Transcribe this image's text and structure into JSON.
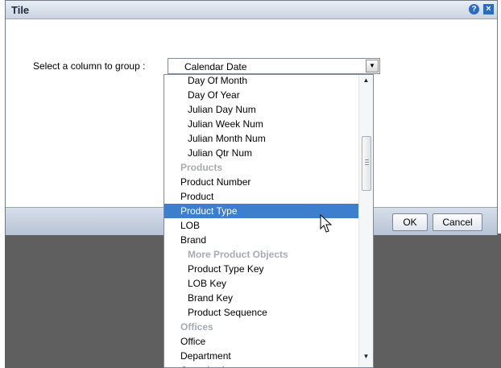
{
  "dialog": {
    "title": "Tile",
    "help_icon": "?",
    "close_icon": "×",
    "group_label": "Select a column to group :",
    "selected_value": "Calendar Date",
    "ok_label": "OK",
    "cancel_label": "Cancel"
  },
  "dropdown": {
    "items": [
      {
        "label": "Day Of Month",
        "kind": "item",
        "indent": 2
      },
      {
        "label": "Day Of Year",
        "kind": "item",
        "indent": 2
      },
      {
        "label": "Julian Day Num",
        "kind": "item",
        "indent": 2
      },
      {
        "label": "Julian Week Num",
        "kind": "item",
        "indent": 2
      },
      {
        "label": "Julian Month Num",
        "kind": "item",
        "indent": 2
      },
      {
        "label": "Julian Qtr Num",
        "kind": "item",
        "indent": 2
      },
      {
        "label": "Products",
        "kind": "group",
        "indent": 1
      },
      {
        "label": "Product Number",
        "kind": "item",
        "indent": 1
      },
      {
        "label": "Product",
        "kind": "item",
        "indent": 1
      },
      {
        "label": "Product Type",
        "kind": "item",
        "indent": 1,
        "selected": true
      },
      {
        "label": "LOB",
        "kind": "item",
        "indent": 1
      },
      {
        "label": "Brand",
        "kind": "item",
        "indent": 1
      },
      {
        "label": "More Product Objects",
        "kind": "group",
        "indent": 2
      },
      {
        "label": "Product Type Key",
        "kind": "item",
        "indent": 2
      },
      {
        "label": "LOB Key",
        "kind": "item",
        "indent": 2
      },
      {
        "label": "Brand Key",
        "kind": "item",
        "indent": 2
      },
      {
        "label": "Product Sequence",
        "kind": "item",
        "indent": 2
      },
      {
        "label": "Offices",
        "kind": "group",
        "indent": 1
      },
      {
        "label": "Office",
        "kind": "item",
        "indent": 1
      },
      {
        "label": "Department",
        "kind": "item",
        "indent": 1
      },
      {
        "label": "Organization",
        "kind": "item",
        "indent": 1
      }
    ]
  },
  "colors": {
    "selection": "#3d7fcf",
    "group_label": "#a7acb3",
    "backdrop": "#5f5f5f"
  }
}
